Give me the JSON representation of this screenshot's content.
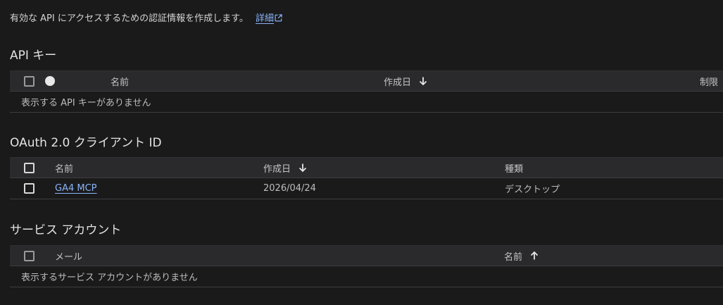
{
  "intro": {
    "text": "有効な API にアクセスするための認証情報を作成します。",
    "link_label": "詳細"
  },
  "api_keys": {
    "title": "API キー",
    "columns": {
      "name": "名前",
      "created": "作成日",
      "restrictions": "制限"
    },
    "empty_message": "表示する API キーがありません"
  },
  "oauth": {
    "title": "OAuth 2.0 クライアント ID",
    "columns": {
      "name": "名前",
      "created": "作成日",
      "type": "種類"
    },
    "rows": [
      {
        "name": "GA4 MCP",
        "created": "2026/04/24",
        "type": "デスクトップ"
      }
    ]
  },
  "service_accounts": {
    "title": "サービス アカウント",
    "columns": {
      "email": "メール",
      "name": "名前"
    },
    "empty_message": "表示するサービス アカウントがありません"
  },
  "colors": {
    "background": "#1a1a1b",
    "header_row": "#2a2a2c",
    "link": "#8ab4f8"
  },
  "icons": {
    "external_link": "open-in-new-icon",
    "sort_desc": "arrow-down-icon",
    "sort_asc": "arrow-up-icon"
  }
}
